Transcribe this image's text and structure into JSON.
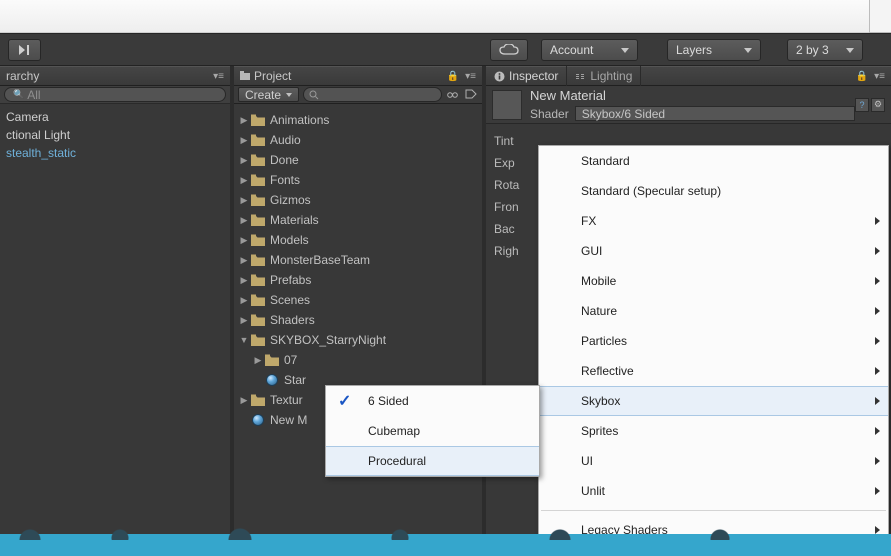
{
  "toolbar": {
    "account": "Account",
    "layers": "Layers",
    "layout": "2 by 3"
  },
  "hierarchy": {
    "title": "rarchy",
    "search_placeholder": "All",
    "items": [
      {
        "label": "Camera",
        "prefab": false
      },
      {
        "label": "ctional Light",
        "prefab": false
      },
      {
        "label": "stealth_static",
        "prefab": true
      }
    ]
  },
  "project": {
    "title": "Project",
    "create": "Create",
    "folders": [
      "Animations",
      "Audio",
      "Done",
      "Fonts",
      "Gizmos",
      "Materials",
      "Models",
      "MonsterBaseTeam",
      "Prefabs",
      "Scenes",
      "Shaders"
    ],
    "skybox_folder": "SKYBOX_StarryNight",
    "skybox_sub": "07",
    "skybox_mat": "Star",
    "textures": "Textur",
    "new_mat": "New M"
  },
  "inspector": {
    "tab1": "Inspector",
    "tab2": "Lighting",
    "material_name": "New Material",
    "shader_label": "Shader",
    "shader_value": "Skybox/6 Sided",
    "props": [
      "Tint",
      "Exp",
      "Rota",
      "Fron",
      "",
      "Bac",
      "",
      "",
      "",
      "Righ"
    ]
  },
  "shader_menu": {
    "items": [
      {
        "label": "Standard",
        "sub": false
      },
      {
        "label": "Standard (Specular setup)",
        "sub": false
      },
      {
        "label": "FX",
        "sub": true
      },
      {
        "label": "GUI",
        "sub": true
      },
      {
        "label": "Mobile",
        "sub": true
      },
      {
        "label": "Nature",
        "sub": true
      },
      {
        "label": "Particles",
        "sub": true
      },
      {
        "label": "Reflective",
        "sub": true
      },
      {
        "label": "Skybox",
        "sub": true,
        "hover": true
      },
      {
        "label": "Sprites",
        "sub": true
      },
      {
        "label": "UI",
        "sub": true
      },
      {
        "label": "Unlit",
        "sub": true
      },
      {
        "label": "_sep",
        "sub": false
      },
      {
        "label": "Legacy Shaders",
        "sub": true
      }
    ]
  },
  "skybox_submenu": {
    "items": [
      {
        "label": "6 Sided",
        "checked": true
      },
      {
        "label": "Cubemap"
      },
      {
        "label": "Procedural",
        "hover": true
      }
    ]
  }
}
